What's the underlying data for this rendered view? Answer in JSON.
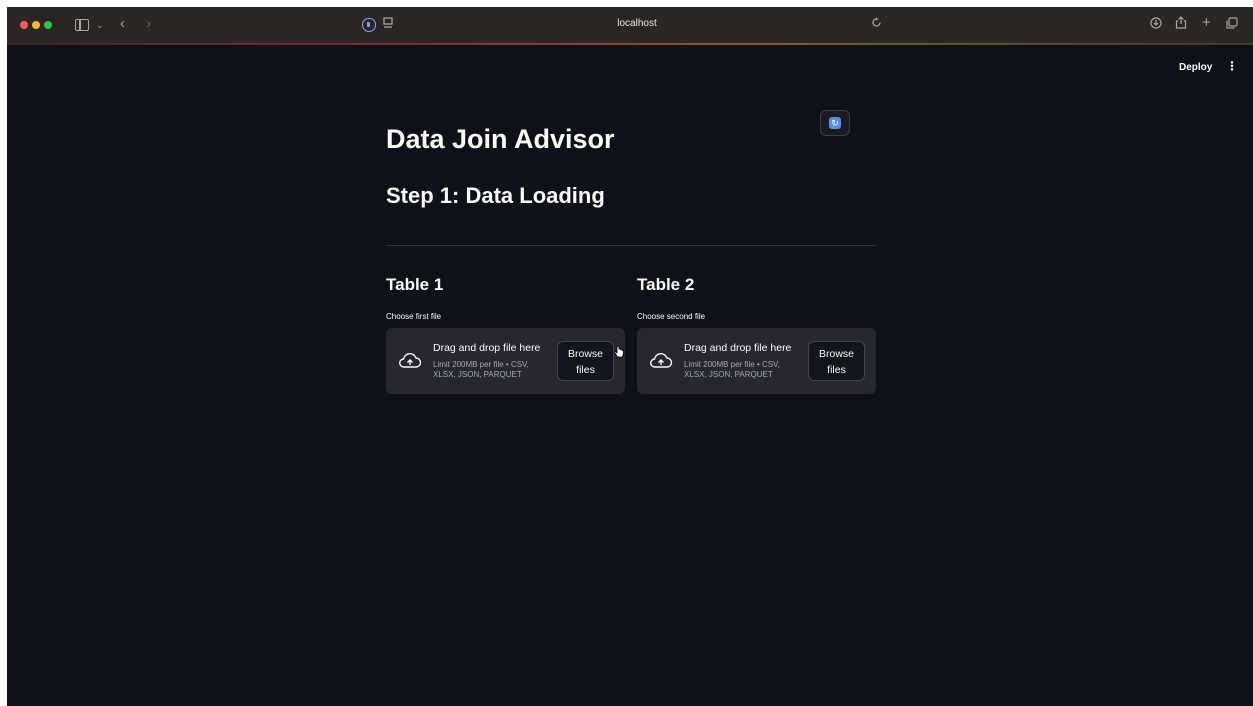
{
  "browser": {
    "url": "localhost",
    "icons": [
      "sidebar-toggle-icon",
      "chevron-down-icon",
      "back-icon",
      "forward-icon",
      "shield-icon",
      "tab-overview-icon",
      "reload-icon",
      "download-icon",
      "share-icon",
      "new-tab-icon",
      "tabs-icon"
    ]
  },
  "app": {
    "deploy_label": "Deploy",
    "menu_glyph": "⋮",
    "title": "Data Join Advisor",
    "step_title": "Step 1: Data Loading",
    "tables": [
      {
        "title": "Table 1",
        "label": "Choose first file",
        "drop_text": "Drag and drop file here",
        "limit_text": "Limit 200MB per file • CSV, XLSX, JSON, PARQUET",
        "browse_line1": "Browse",
        "browse_line2": "files"
      },
      {
        "title": "Table 2",
        "label": "Choose second file",
        "drop_text": "Drag and drop file here",
        "limit_text": "Limit 200MB per file • CSV, XLSX, JSON, PARQUET",
        "browse_line1": "Browse",
        "browse_line2": "files"
      }
    ]
  },
  "colors": {
    "background": "#0e1117",
    "dropzone": "#262730",
    "text": "#fafafa",
    "muted_text": "#a3a8b4"
  }
}
